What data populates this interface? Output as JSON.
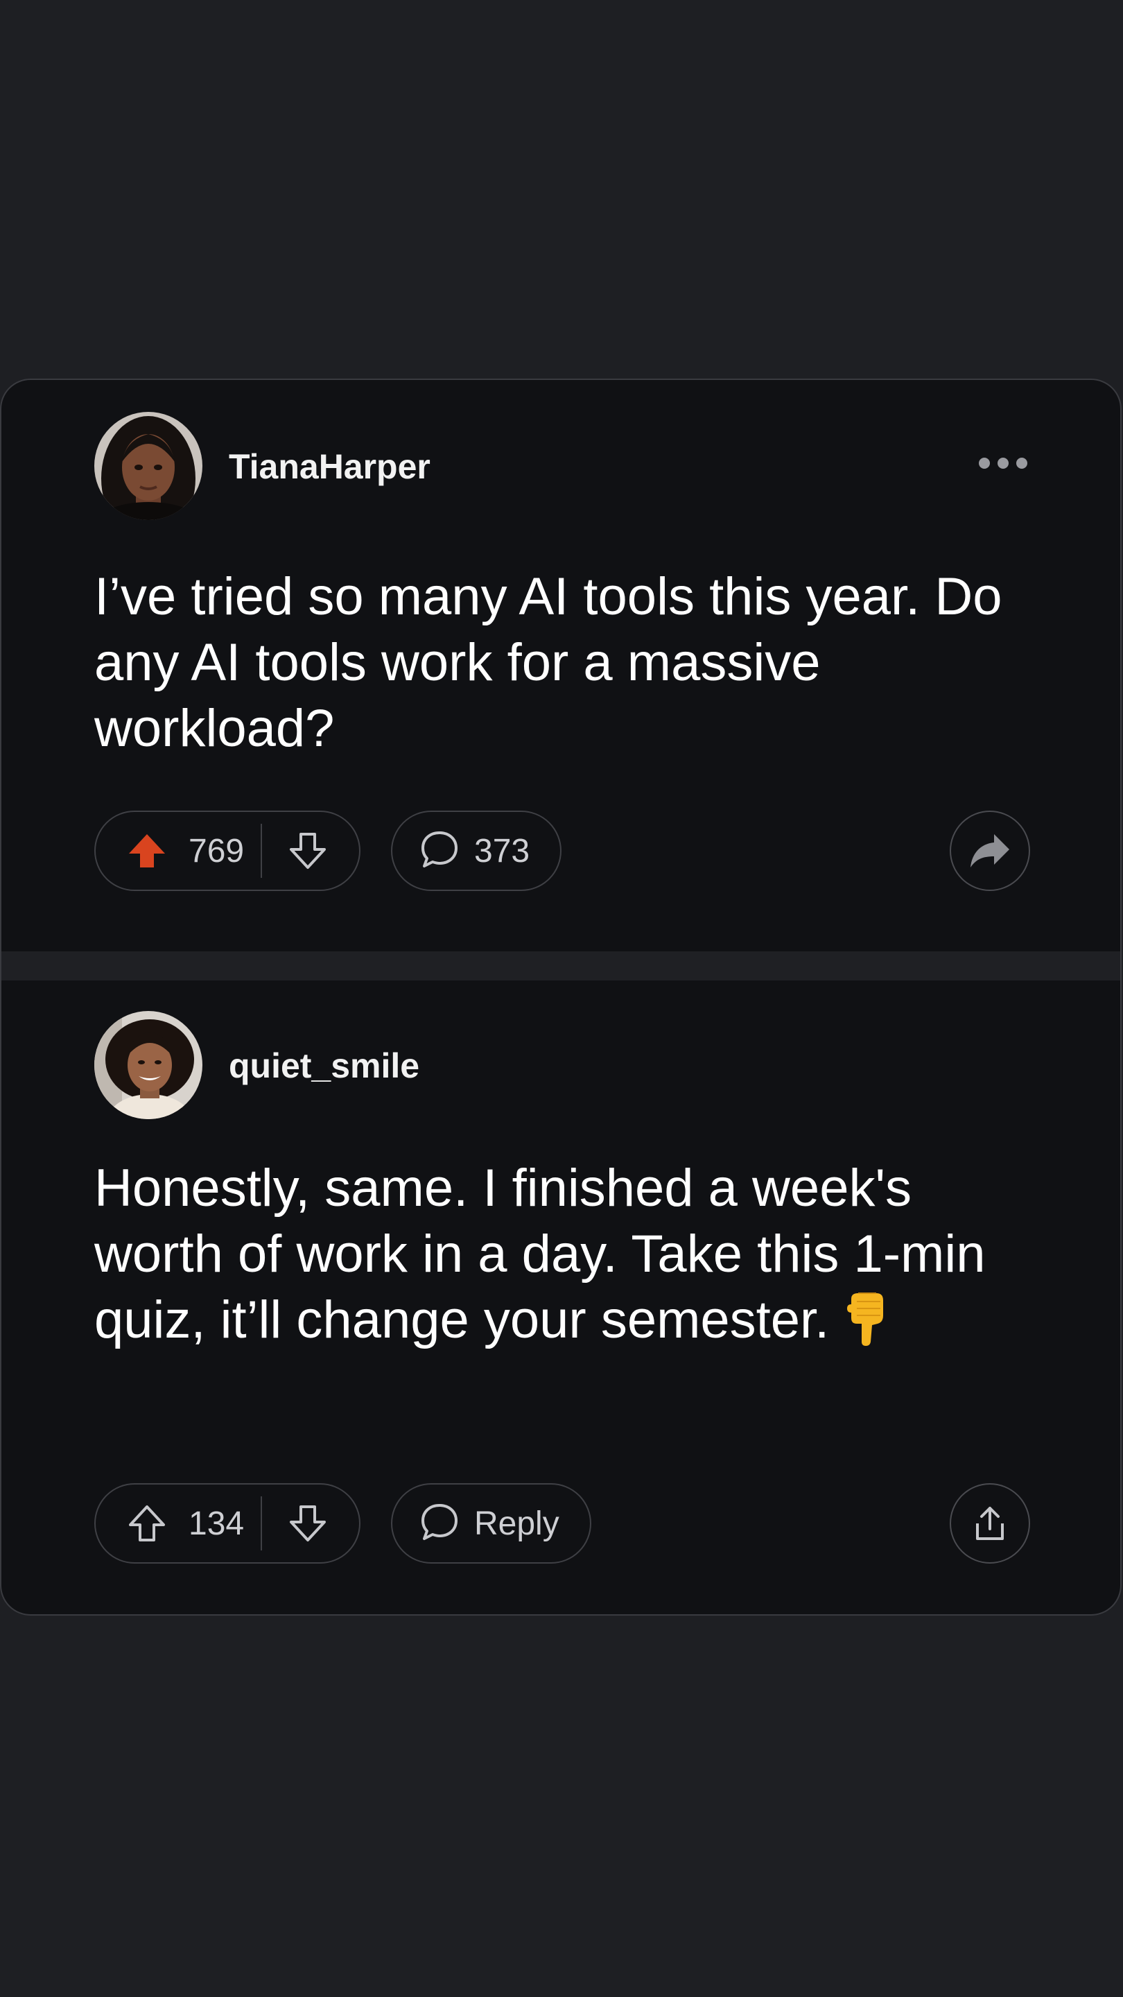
{
  "post": {
    "username": "TianaHarper",
    "text": "I’ve tried so many AI tools this year. Do any AI tools work for a massive workload?",
    "upvotes": "769",
    "comments": "373",
    "upvoted": true,
    "accent_color": "#d9441f"
  },
  "reply": {
    "username": "quiet_smile",
    "text": "Honestly, same. I finished a week's worth of work in a day. Take this 1-min quiz, it’ll change your semester.",
    "emoji": "backhand-index-pointing-down",
    "upvotes": "134",
    "reply_label": "Reply"
  },
  "icons": {
    "more": "more-horizontal-icon",
    "share_post": "share-arrow-icon",
    "share_reply": "share-upload-icon"
  }
}
